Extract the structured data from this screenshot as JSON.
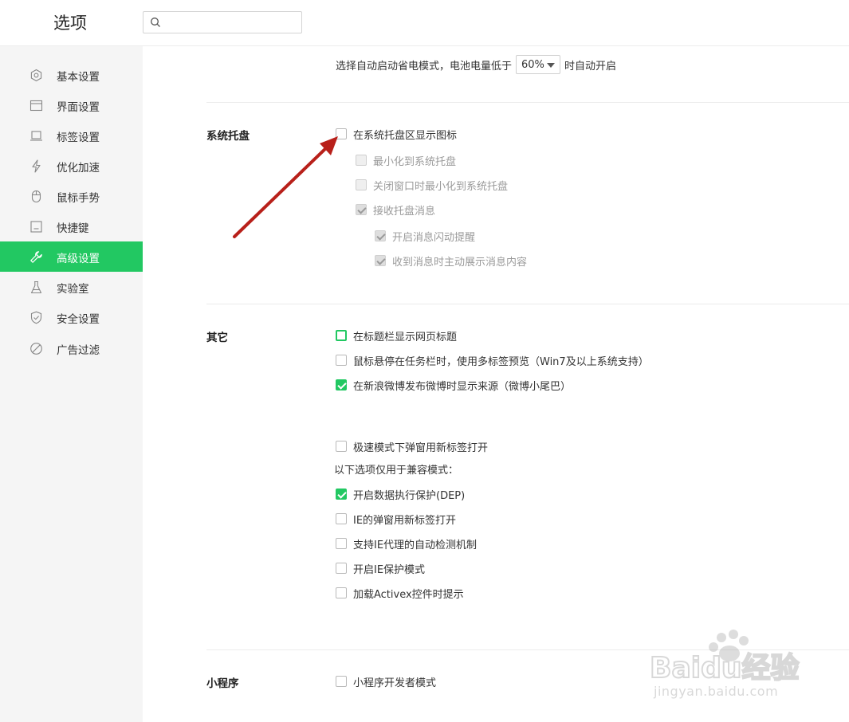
{
  "header": {
    "title": "选项",
    "search": {
      "value": "",
      "placeholder": ""
    }
  },
  "sidebar": {
    "items": [
      {
        "label": "基本设置",
        "icon": "gear-icon",
        "active": false
      },
      {
        "label": "界面设置",
        "icon": "window-icon",
        "active": false
      },
      {
        "label": "标签设置",
        "icon": "tab-icon",
        "active": false
      },
      {
        "label": "优化加速",
        "icon": "lightning-icon",
        "active": false
      },
      {
        "label": "鼠标手势",
        "icon": "mouse-icon",
        "active": false
      },
      {
        "label": "快捷键",
        "icon": "keyboard-icon",
        "active": false
      },
      {
        "label": "高级设置",
        "icon": "wrench-icon",
        "active": true
      },
      {
        "label": "实验室",
        "icon": "flask-icon",
        "active": false
      },
      {
        "label": "安全设置",
        "icon": "shield-icon",
        "active": false
      },
      {
        "label": "广告过滤",
        "icon": "block-icon",
        "active": false
      }
    ]
  },
  "power_saving": {
    "prefix": "选择自动启动省电模式，电池电量低于",
    "battery_threshold": "60%",
    "suffix": "时自动开启"
  },
  "tray": {
    "title": "系统托盘",
    "options": [
      {
        "label": "在系统托盘区显示图标",
        "checked": false,
        "disabled": false
      },
      {
        "label": "最小化到系统托盘",
        "checked": false,
        "disabled": true
      },
      {
        "label": "关闭窗口时最小化到系统托盘",
        "checked": false,
        "disabled": true
      },
      {
        "label": "接收托盘消息",
        "checked": true,
        "disabled": true
      },
      {
        "label": "开启消息闪动提醒",
        "checked": true,
        "disabled": true
      },
      {
        "label": "收到消息时主动展示消息内容",
        "checked": true,
        "disabled": true
      }
    ]
  },
  "other": {
    "title": "其它",
    "options": [
      {
        "label": "在标题栏显示网页标题",
        "checked": false,
        "focused": true
      },
      {
        "label": "鼠标悬停在任务栏时，使用多标签预览（Win7及以上系统支持）",
        "checked": false
      },
      {
        "label": "在新浪微博发布微博时显示来源（微博小尾巴）",
        "checked": true
      },
      {
        "label": "极速模式下弹窗用新标签打开",
        "checked": false
      }
    ],
    "compat_note": "以下选项仅用于兼容模式：",
    "compat_options": [
      {
        "label": "开启数据执行保护(DEP)",
        "checked": true
      },
      {
        "label": "IE的弹窗用新标签打开",
        "checked": false
      },
      {
        "label": "支持IE代理的自动检测机制",
        "checked": false
      },
      {
        "label": "开启IE保护模式",
        "checked": false
      },
      {
        "label": "加载Activex控件时提示",
        "checked": false
      }
    ]
  },
  "miniprogram": {
    "title": "小程序",
    "options": [
      {
        "label": "小程序开发者模式",
        "checked": false
      }
    ]
  },
  "watermark": {
    "brand": "Baidu经验",
    "domain": "jingyan.baidu.com"
  },
  "colors": {
    "accent": "#22c862",
    "annotation_arrow": "#b8201a",
    "sidebar_bg": "#f5f5f5"
  }
}
